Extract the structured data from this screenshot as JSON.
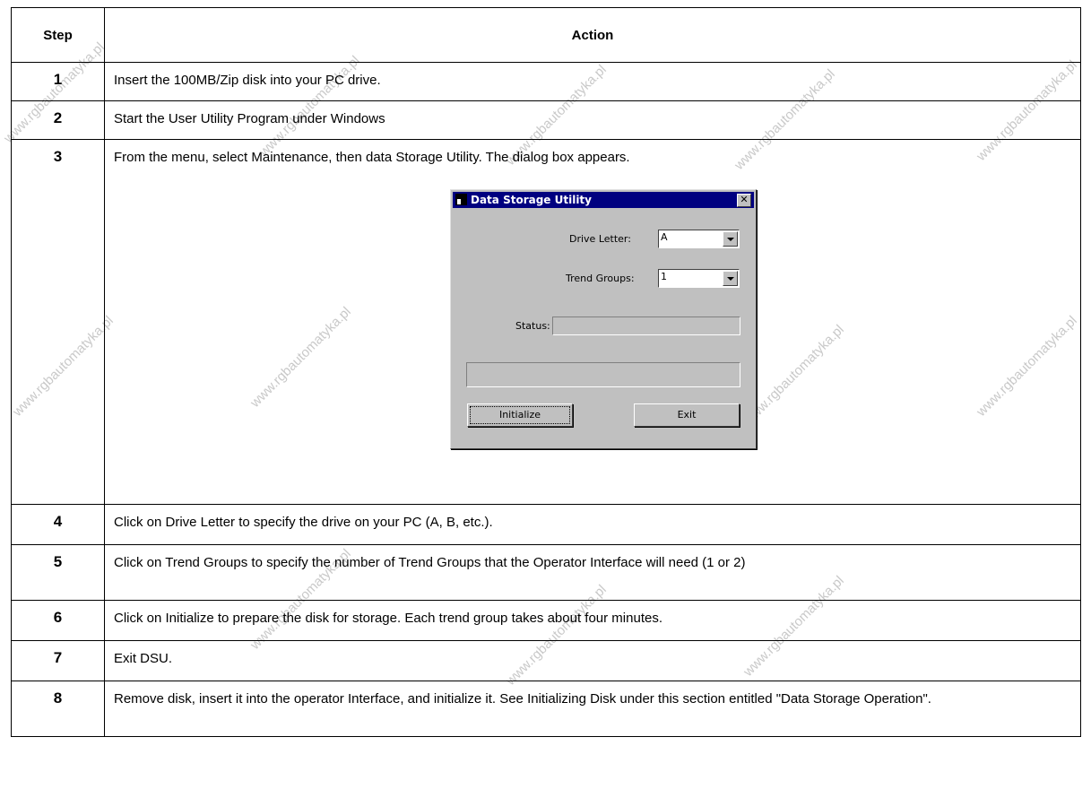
{
  "table": {
    "header": {
      "step": "Step",
      "action": "Action"
    },
    "rows": [
      {
        "step": "1",
        "action": "Insert the 100MB/Zip disk into your PC drive."
      },
      {
        "step": "2",
        "action": "Start the User Utility Program under Windows"
      },
      {
        "step": "3",
        "action": "From the menu, select Maintenance, then data Storage Utility.  The dialog box appears."
      },
      {
        "step": "4",
        "action": "Click on Drive Letter to specify the drive on your PC (A, B, etc.)."
      },
      {
        "step": "5",
        "action": "Click on Trend Groups to specify the number of Trend Groups that the Operator Interface will need (1 or 2)"
      },
      {
        "step": "6",
        "action": "Click on Initialize to prepare the disk for storage.  Each trend group takes about four minutes."
      },
      {
        "step": "7",
        "action": "Exit DSU."
      },
      {
        "step": "8",
        "action": "Remove disk, insert it into the operator Interface, and initialize it.  See Initializing Disk under this section entitled \"Data Storage Operation\"."
      }
    ]
  },
  "dialog": {
    "title": "Data Storage Utility",
    "close_glyph": "✕",
    "drive_letter_label": "Drive Letter:",
    "drive_letter_value": "A",
    "trend_groups_label": "Trend Groups:",
    "trend_groups_value": "1",
    "status_label": "Status:",
    "status_value": "",
    "progress_value": "",
    "initialize_label": "Initialize",
    "exit_label": "Exit"
  },
  "watermark": "www.rgbautomatyka.pl"
}
